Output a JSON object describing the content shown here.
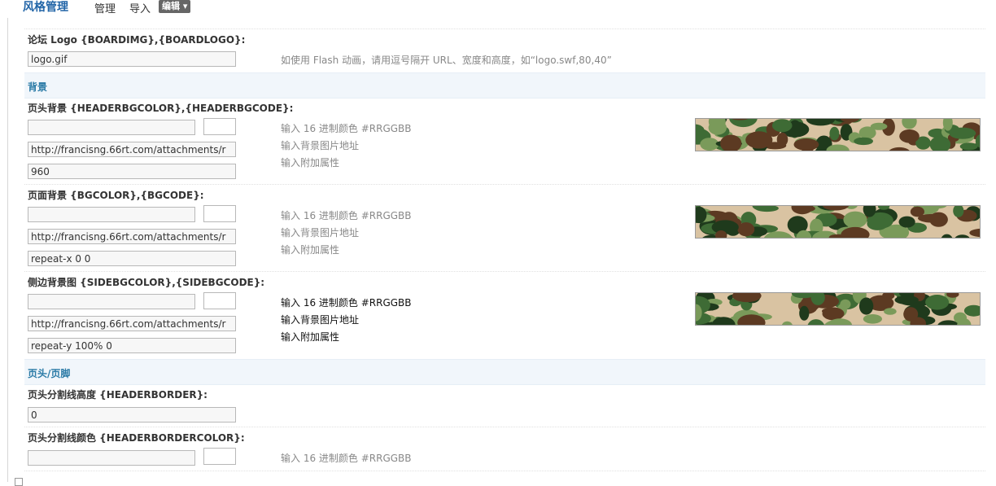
{
  "header": {
    "title": "风格管理",
    "nav": [
      "管理",
      "导入"
    ],
    "edit_label": "编辑 ▾"
  },
  "logo_row": {
    "label": "论坛 Logo {BOARDIMG},{BOARDLOGO}:",
    "value": "logo.gif",
    "tip": "如使用 Flash 动画，请用逗号隔开 URL、宽度和高度，如“logo.swf,80,40”"
  },
  "sections": {
    "background": "背景",
    "header_footer": "页头/页脚"
  },
  "header_bg": {
    "label": "页头背景 {HEADERBGCOLOR},{HEADERBGCODE}:",
    "color_value": "",
    "image_value": "http://francisng.66rt.com/attachments/r",
    "extra_value": "960",
    "tips": [
      "输入 16 进制颜色 #RRGGBB",
      "输入背景图片地址",
      "输入附加属性"
    ]
  },
  "page_bg": {
    "label": "页面背景 {BGCOLOR},{BGCODE}:",
    "color_value": "",
    "image_value": "http://francisng.66rt.com/attachments/r",
    "extra_value": "repeat-x 0 0",
    "tips": [
      "输入 16 进制颜色 #RRGGBB",
      "输入背景图片地址",
      "输入附加属性"
    ]
  },
  "side_bg": {
    "label": "侧边背景图 {SIDEBGCOLOR},{SIDEBGCODE}:",
    "color_value": "",
    "image_value": "http://francisng.66rt.com/attachments/r",
    "extra_value": "repeat-y 100% 0",
    "tips": [
      "输入 16 进制颜色 #RRGGBB",
      "输入背景图片地址",
      "输入附加属性"
    ]
  },
  "header_border": {
    "label": "页头分割线高度 {HEADERBORDER}:",
    "value": "0"
  },
  "header_border_color": {
    "label": "页头分割线颜色 {HEADERBORDERCOLOR}:",
    "color_value": "",
    "tip": "输入 16 进制颜色 #RRGGBB"
  },
  "colors": {
    "accent": "#2366a8",
    "section_bg": "#f1f6fb",
    "section_text": "#2a7aa6"
  }
}
